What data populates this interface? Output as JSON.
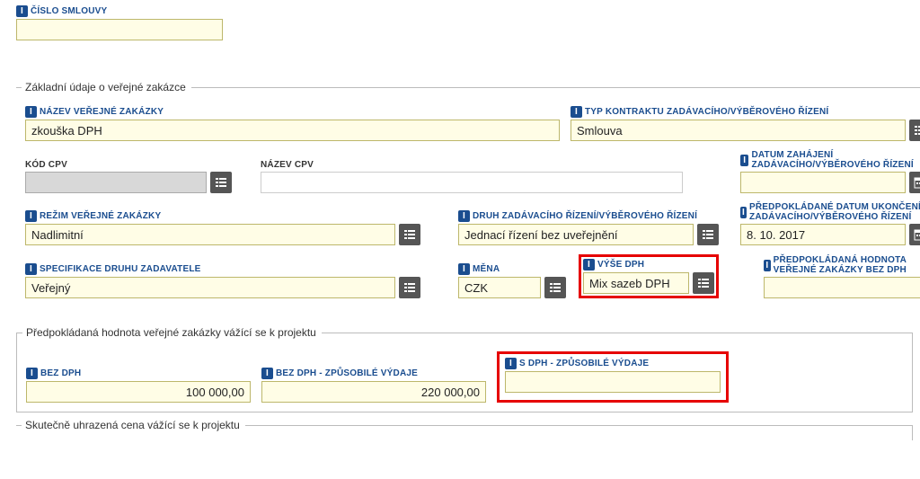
{
  "contract_number": {
    "label": "ČÍSLO SMLOUVY",
    "value": ""
  },
  "basic": {
    "legend": "Základní údaje o veřejné zakázce",
    "name": {
      "label": "NÁZEV VEŘEJNÉ ZAKÁZKY",
      "value": "zkouška DPH"
    },
    "contract_type": {
      "label": "TYP KONTRAKTU ZADÁVACÍHO/VÝBĚROVÉHO ŘÍZENÍ",
      "value": "Smlouva"
    },
    "cpv_code": {
      "label": "KÓD CPV",
      "value": ""
    },
    "cpv_name": {
      "label": "NÁZEV CPV",
      "value": ""
    },
    "start_date": {
      "label": "DATUM ZAHÁJENÍ ZADÁVACÍHO/VÝBĚROVÉHO ŘÍZENÍ",
      "value": ""
    },
    "regime": {
      "label": "REŽIM VEŘEJNÉ ZAKÁZKY",
      "value": "Nadlimitní"
    },
    "procedure_type": {
      "label": "DRUH ZADÁVACÍHO ŘÍZENÍ/VÝBĚROVÉHO ŘÍZENÍ",
      "value": "Jednací řízení bez uveřejnění"
    },
    "expected_end": {
      "label": "PŘEDPOKLÁDANÉ DATUM UKONČENÍ ZADÁVACÍHO/VÝBĚROVÉHO ŘÍZENÍ",
      "value": "8. 10. 2017"
    },
    "authority_type": {
      "label": "SPECIFIKACE DRUHU ZADAVATELE",
      "value": "Veřejný"
    },
    "currency": {
      "label": "MĚNA",
      "value": "CZK"
    },
    "vat_rate": {
      "label": "VÝŠE DPH",
      "value": "Mix sazeb DPH"
    },
    "expected_value": {
      "label": "PŘEDPOKLÁDANÁ HODNOTA VEŘEJNÉ ZAKÁZKY BEZ DPH",
      "value": ""
    }
  },
  "project_value": {
    "legend": "Předpokládaná hodnota veřejné zakázky vážící se k projektu",
    "without_vat": {
      "label": "BEZ DPH",
      "value": "100 000,00"
    },
    "without_vat_eligible": {
      "label": "BEZ DPH - ZPŮSOBILÉ VÝDAJE",
      "value": "220 000,00"
    },
    "with_vat_eligible": {
      "label": "S DPH - ZPŮSOBILÉ VÝDAJE",
      "value": ""
    }
  },
  "actual_paid": {
    "legend": "Skutečně uhrazená cena vážící se k projektu"
  }
}
